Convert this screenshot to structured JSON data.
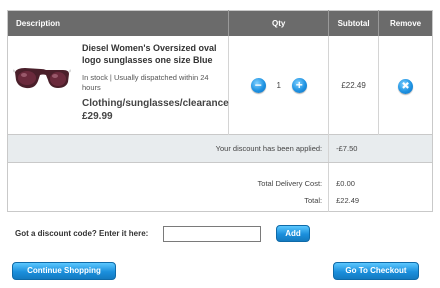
{
  "table": {
    "headers": [
      "Description",
      "Qty",
      "Subtotal",
      "Remove"
    ]
  },
  "item": {
    "name": "Diesel Women's Oversized oval logo sunglasses one size Blue",
    "stock": "In stock | Usually dispatched within 24 hours",
    "category": "Clothing/sunglasses/clearance",
    "price": "£29.99",
    "quantity": "1",
    "subtotal": "£22.49",
    "image_icon": "sunglasses-image"
  },
  "discount": {
    "label": "Your discount has been applied:",
    "value": "-£7.50"
  },
  "totals": {
    "delivery_label": "Total Delivery Cost:",
    "delivery_value": "£0.00",
    "total_label": "Total:",
    "total_value": "£22.49"
  },
  "promo": {
    "label": "Got a discount code? Enter it here:",
    "value": "",
    "add_label": "Add"
  },
  "actions": {
    "continue_label": "Continue Shopping",
    "checkout_label": "Go To Checkout"
  },
  "colors": {
    "header_bg": "#6b6b6b",
    "button_blue": "#1b8fdc",
    "discount_bg": "#e8ecee"
  }
}
